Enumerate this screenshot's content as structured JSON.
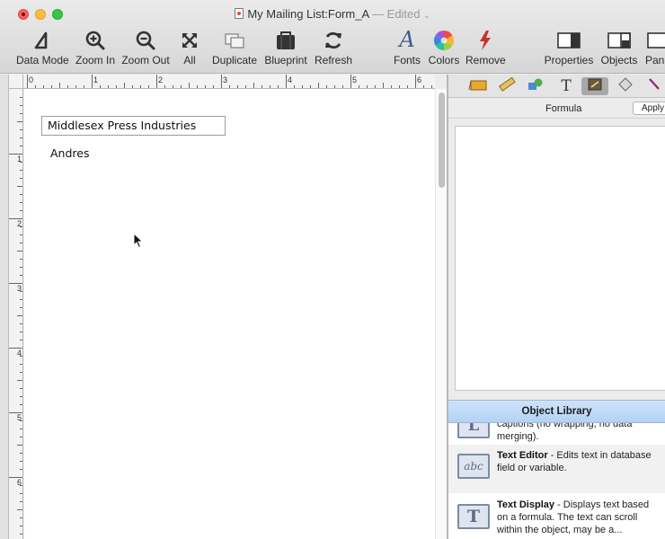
{
  "window": {
    "title": "My Mailing List:Form_A",
    "edited": "— Edited",
    "chevron": "⌄"
  },
  "toolbar": {
    "data_mode": "Data Mode",
    "zoom_in": "Zoom In",
    "zoom_out": "Zoom Out",
    "all": "All",
    "duplicate": "Duplicate",
    "blueprint": "Blueprint",
    "refresh": "Refresh",
    "fonts": "Fonts",
    "colors": "Colors",
    "remove": "Remove",
    "properties": "Properties",
    "objects": "Objects",
    "panels": "Pan"
  },
  "ruler": {
    "h_numbers": [
      "0",
      "1",
      "2",
      "3",
      "4",
      "5",
      "6"
    ],
    "v_numbers": [
      "1",
      "2",
      "3",
      "4",
      "5",
      "6"
    ]
  },
  "form": {
    "field_company": "Middlesex Press Industries",
    "field_first": "Andres"
  },
  "panel": {
    "formula_label": "Formula",
    "apply_label": "Apply",
    "library_title": "Object Library",
    "items": [
      {
        "icon_char": "L",
        "name": "",
        "desc": "captions (no wrapping, no data merging)."
      },
      {
        "icon_char": "abc",
        "name": "Text Editor",
        "desc": " - Edits text in database field or variable."
      },
      {
        "icon_char": "T",
        "name": "Text Display",
        "desc": " - Displays text based on a formula. The text can scroll within the object, may be a..."
      }
    ]
  }
}
